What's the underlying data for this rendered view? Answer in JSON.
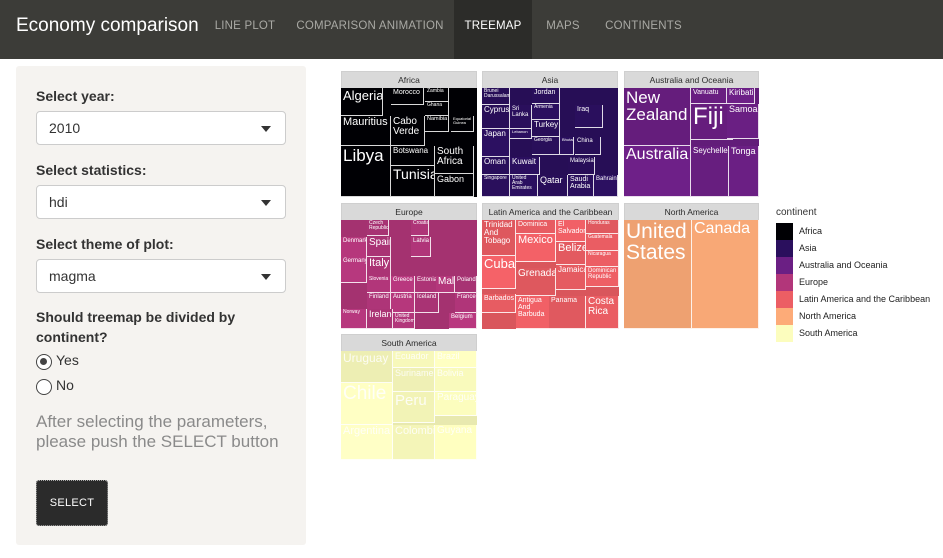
{
  "app": {
    "title": "Economy comparison",
    "tabs": [
      {
        "label": "LINE PLOT",
        "active": false
      },
      {
        "label": "COMPARISON ANIMATION",
        "active": false
      },
      {
        "label": "TREEMAP",
        "active": true
      },
      {
        "label": "MAPS",
        "active": false
      },
      {
        "label": "CONTINENTS",
        "active": false
      }
    ]
  },
  "sidebar": {
    "year_label": "Select year:",
    "year_value": "2010",
    "stat_label": "Select statistics:",
    "stat_value": "hdi",
    "theme_label": "Select theme of plot:",
    "theme_value": "magma",
    "divide_label": "Should treemap be divided by continent?",
    "radio_yes": "Yes",
    "radio_no": "No",
    "radio_selected": "Yes",
    "hint": "After selecting the parameters, please push the SELECT button",
    "select_button": "SELECT"
  },
  "colors": {
    "Africa": "#000004",
    "Asia": "#2a0f5d",
    "Australia and Oceania": "#6b1f84",
    "Europe": "#b2367a",
    "Latin America and the Caribbean": "#ec5e64",
    "North America": "#fdab78",
    "South America": "#fcfdbe"
  },
  "legend": {
    "title": "continent",
    "items": [
      "Africa",
      "Asia",
      "Australia and Oceania",
      "Europe",
      "Latin America and the Caribbean",
      "North America",
      "South America"
    ]
  },
  "treemap": {
    "panels": [
      {
        "title": "Africa",
        "continent": "Africa",
        "labels": [
          "Algeria",
          "Morocco",
          "Zambia",
          "Ghana",
          "Namibia",
          "Equatorial Guinea",
          "Mauritius",
          "Cabo Verde",
          "Botswana",
          "South Africa",
          "Libya",
          "Tunisia",
          "Gabon"
        ]
      },
      {
        "title": "Asia",
        "continent": "Asia",
        "labels": [
          "Brunei Darussalam",
          "Jordan",
          "Armenia",
          "Cyprus",
          "Sri Lanka",
          "Lebanon",
          "Turkey",
          "Iraq",
          "Japan",
          "Georgia",
          "Bhutan",
          "China",
          "Oman",
          "Kuwait",
          "Malaysia",
          "Singapore",
          "United Arab Emirates",
          "Qatar",
          "Saudi Arabia",
          "Bahrain"
        ]
      },
      {
        "title": "Australia and Oceania",
        "continent": "Australia and Oceania",
        "labels": [
          "New Zealand",
          "Vanuatu",
          "Kiribati",
          "Fiji",
          "Samoa",
          "Australia",
          "Seychelles",
          "Tonga"
        ]
      },
      {
        "title": "Europe",
        "continent": "Europe",
        "labels": [
          "Czech Republic",
          "Croatia",
          "Denmark",
          "Spain",
          "Latvia",
          "Germany",
          "Italy",
          "Slovenia",
          "Greece",
          "Estonia",
          "Malta",
          "Poland",
          "Finland",
          "Austria",
          "Iceland",
          "France",
          "Norway",
          "Ireland",
          "United Kingdom",
          "Belgium"
        ]
      },
      {
        "title": "Latin America and the Caribbean",
        "continent": "Latin America and the Caribbean",
        "labels": [
          "Trinidad And Tobago",
          "Dominica",
          "El Salvador",
          "Honduras",
          "Guatemala",
          "Mexico",
          "Belize",
          "Nicaragua",
          "Cuba",
          "Jamaica",
          "Dominican Republic",
          "Grenada",
          "Barbados",
          "Antigua And Barbuda",
          "Panama",
          "Costa Rica"
        ]
      },
      {
        "title": "North America",
        "continent": "North America",
        "labels": [
          "United States",
          "Canada"
        ]
      },
      {
        "title": "South America",
        "continent": "South America",
        "labels": [
          "Uruguay",
          "Ecuador",
          "Brazil",
          "Suriname",
          "Bolivia",
          "Chile",
          "Peru",
          "Paraguay",
          "Argentina",
          "Colombia",
          "Guyana"
        ]
      }
    ]
  }
}
